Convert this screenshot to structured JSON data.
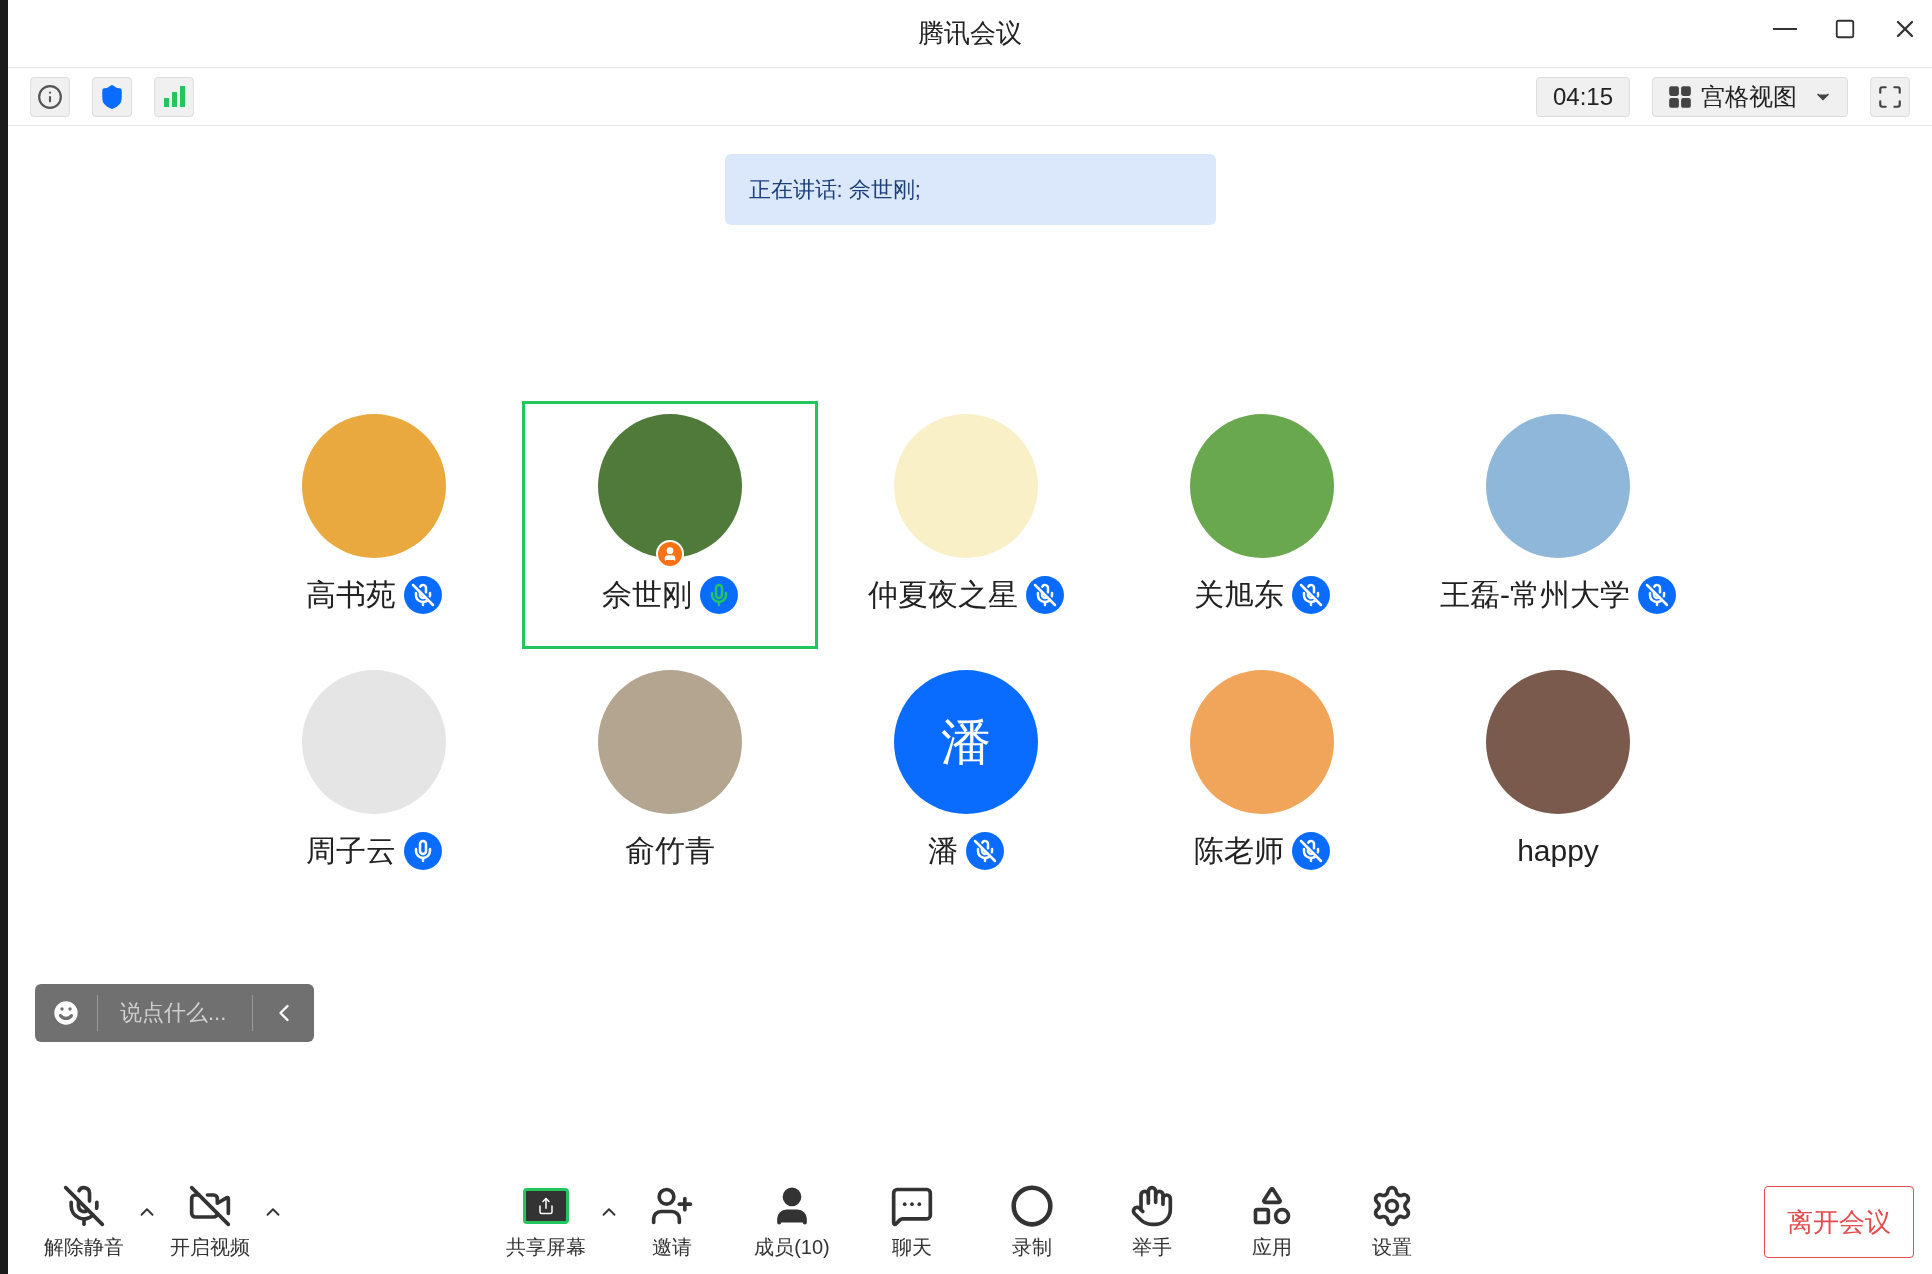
{
  "window": {
    "title": "腾讯会议"
  },
  "info_bar": {
    "timer": "04:15",
    "view_button": "宫格视图"
  },
  "speaking_banner": "正在讲话: 佘世刚;",
  "participants": [
    {
      "name": "高书苑",
      "mic": {
        "muted": true,
        "speaking": false
      },
      "avatar": {
        "kind": "photo",
        "color": "#e9a93e"
      },
      "host": false,
      "selected": false
    },
    {
      "name": "佘世刚",
      "mic": {
        "muted": false,
        "speaking": true
      },
      "avatar": {
        "kind": "photo",
        "color": "#4f7a3a"
      },
      "host": true,
      "selected": true
    },
    {
      "name": "仲夏夜之星",
      "mic": {
        "muted": true,
        "speaking": false
      },
      "avatar": {
        "kind": "photo",
        "color": "#faf0c8"
      },
      "host": false,
      "selected": false
    },
    {
      "name": "关旭东",
      "mic": {
        "muted": true,
        "speaking": false
      },
      "avatar": {
        "kind": "photo",
        "color": "#6aa84f"
      },
      "host": false,
      "selected": false
    },
    {
      "name": "王磊-常州大学",
      "mic": {
        "muted": true,
        "speaking": false
      },
      "avatar": {
        "kind": "photo",
        "color": "#8fb7d9"
      },
      "host": false,
      "selected": false
    },
    {
      "name": "周子云",
      "mic": {
        "muted": false,
        "speaking": false
      },
      "avatar": {
        "kind": "photo",
        "color": "#e5e5e5"
      },
      "host": false,
      "selected": false
    },
    {
      "name": "俞竹青",
      "avatar": {
        "kind": "photo",
        "color": "#b3a58f"
      },
      "host": false,
      "selected": false
    },
    {
      "name": "潘",
      "mic": {
        "muted": true,
        "speaking": false
      },
      "avatar": {
        "kind": "initial",
        "text": "潘",
        "color": "#0a6cff"
      },
      "host": false,
      "selected": false
    },
    {
      "name": "陈老师",
      "mic": {
        "muted": true,
        "speaking": false
      },
      "avatar": {
        "kind": "photo",
        "color": "#f0a55a"
      },
      "host": false,
      "selected": false
    },
    {
      "name": "happy",
      "avatar": {
        "kind": "photo",
        "color": "#7b5a4e"
      },
      "host": false,
      "selected": false
    }
  ],
  "chat_box": {
    "placeholder": "说点什么..."
  },
  "toolbar": [
    {
      "kind": "mic",
      "label": "解除静音",
      "menu": true
    },
    {
      "kind": "video",
      "label": "开启视频",
      "menu": true
    },
    {
      "kind": "share",
      "label": "共享屏幕",
      "menu": true
    },
    {
      "kind": "invite",
      "label": "邀请"
    },
    {
      "kind": "members",
      "label": "成员(10)"
    },
    {
      "kind": "chat",
      "label": "聊天"
    },
    {
      "kind": "record",
      "label": "录制"
    },
    {
      "kind": "hand",
      "label": "举手"
    },
    {
      "kind": "apps",
      "label": "应用"
    },
    {
      "kind": "settings",
      "label": "设置"
    }
  ],
  "leave_button": "离开会议"
}
